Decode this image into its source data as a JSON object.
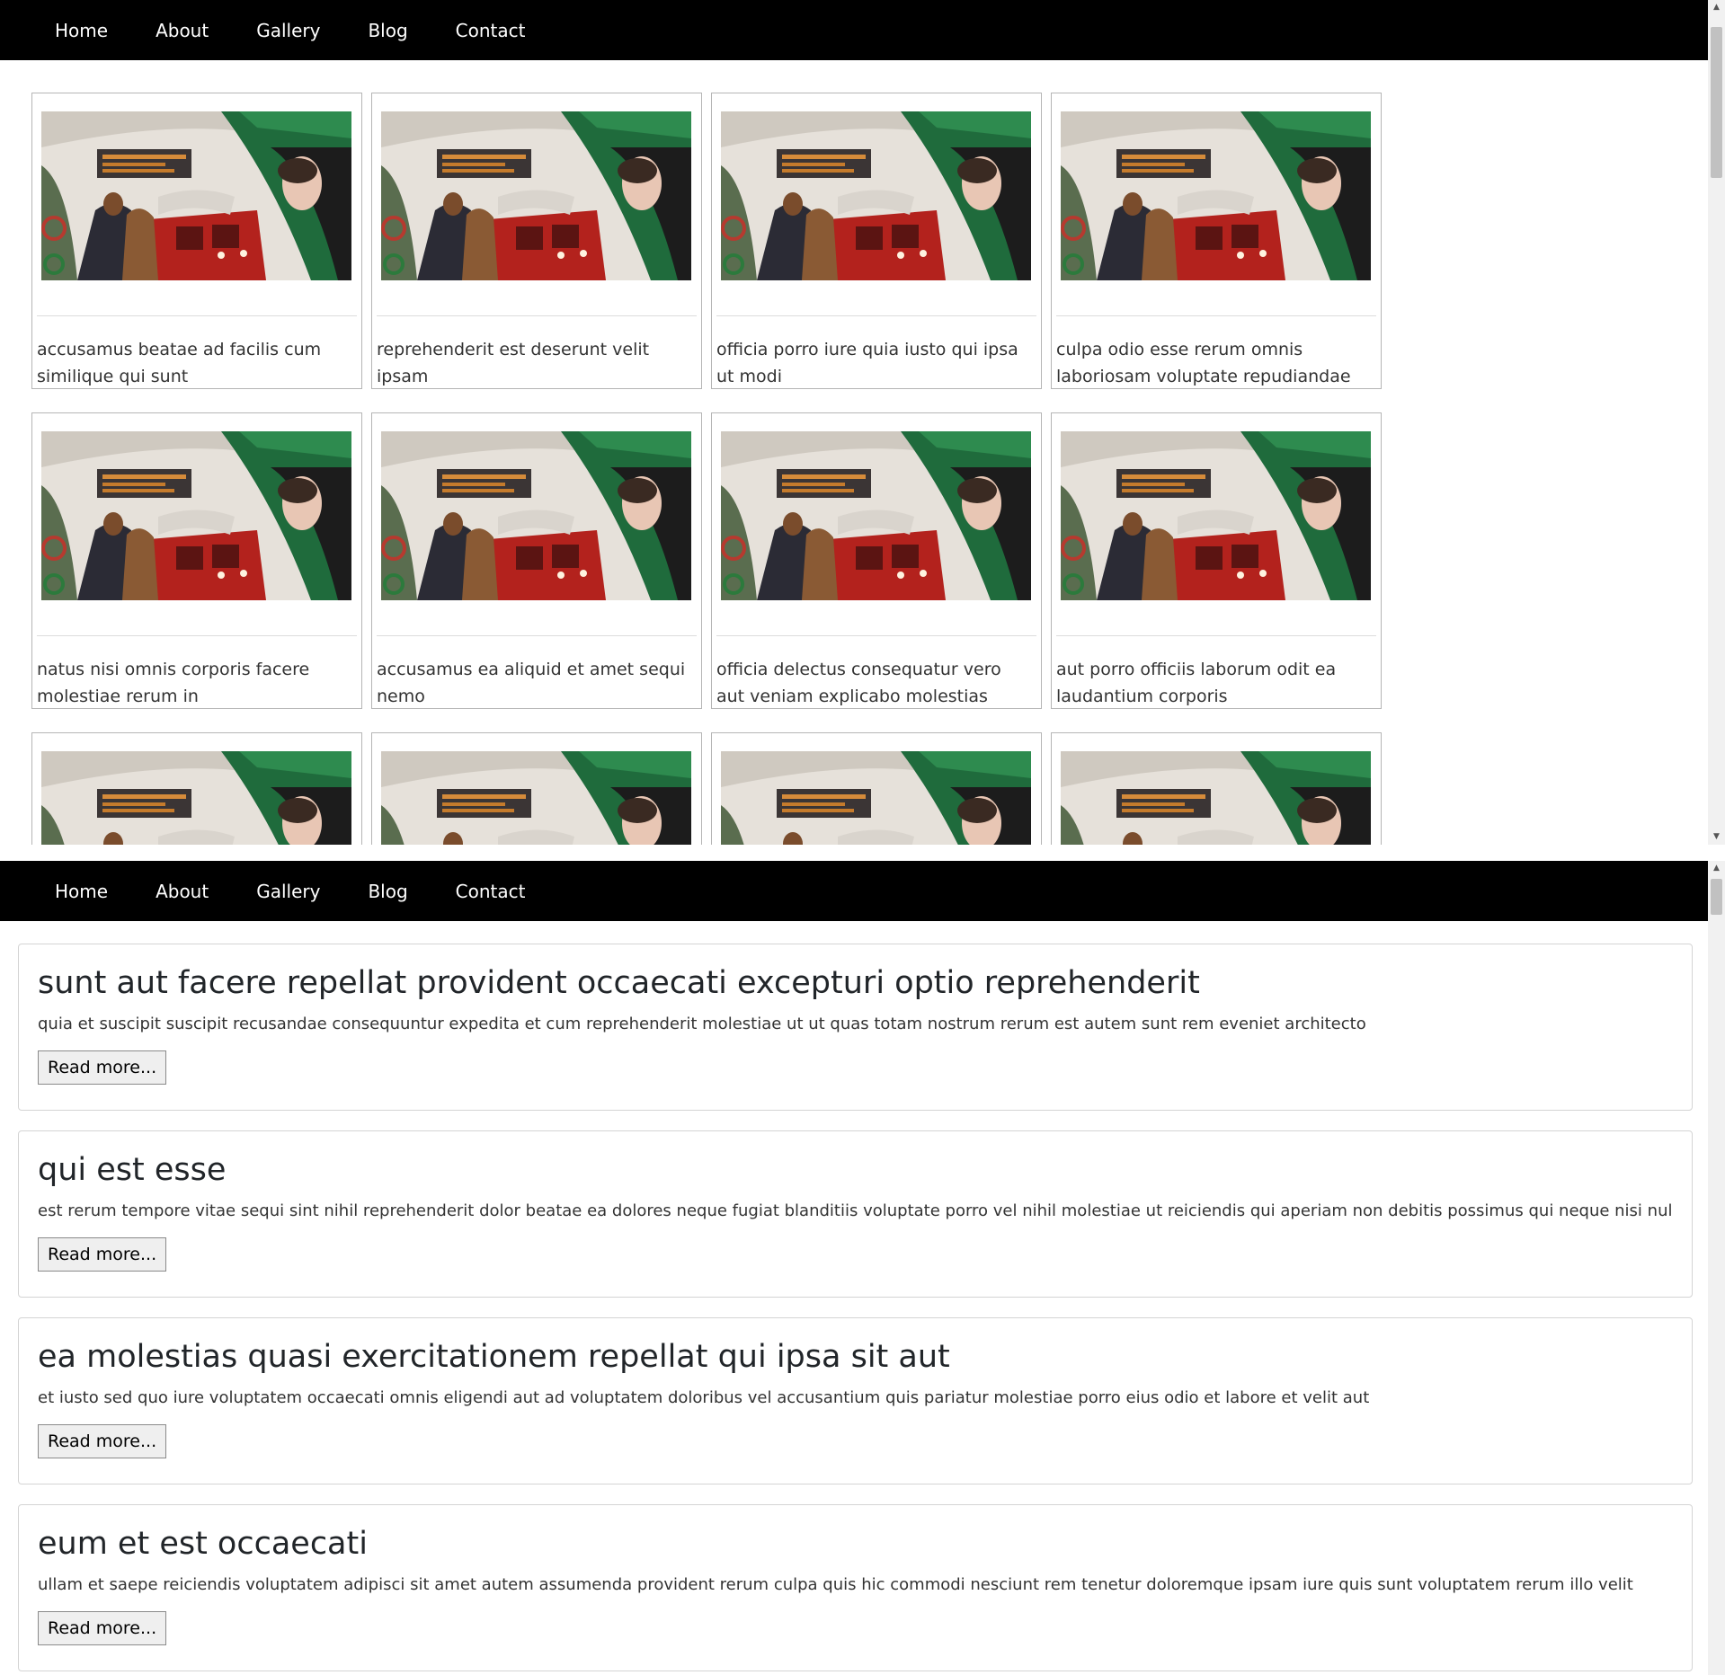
{
  "nav": {
    "items": [
      "Home",
      "About",
      "Gallery",
      "Blog",
      "Contact"
    ]
  },
  "gallery": {
    "captions": [
      "accusamus beatae ad facilis cum similique qui sunt",
      "reprehenderit est deserunt velit ipsam",
      "officia porro iure quia iusto qui ipsa ut modi",
      "culpa odio esse rerum omnis laboriosam voluptate repudiandae",
      "natus nisi omnis corporis facere molestiae rerum in",
      "accusamus ea aliquid et amet sequi nemo",
      "officia delectus consequatur vero aut veniam explicabo molestias",
      "aut porro officiis laborum odit ea laudantium corporis",
      "",
      "",
      "",
      ""
    ]
  },
  "posts": [
    {
      "title": "sunt aut facere repellat provident occaecati excepturi optio reprehenderit",
      "body": "quia et suscipit suscipit recusandae consequuntur expedita et cum reprehenderit molestiae ut ut quas totam nostrum rerum est autem sunt rem eveniet architecto",
      "button": "Read more..."
    },
    {
      "title": "qui est esse",
      "body": "est rerum tempore vitae sequi sint nihil reprehenderit dolor beatae ea dolores neque fugiat blanditiis voluptate porro vel nihil molestiae ut reiciendis qui aperiam non debitis possimus qui neque nisi nulla",
      "button": "Read more..."
    },
    {
      "title": "ea molestias quasi exercitationem repellat qui ipsa sit aut",
      "body": "et iusto sed quo iure voluptatem occaecati omnis eligendi aut ad voluptatem doloribus vel accusantium quis pariatur molestiae porro eius odio et labore et velit aut",
      "button": "Read more..."
    },
    {
      "title": "eum et est occaecati",
      "body": "ullam et saepe reiciendis voluptatem adipisci sit amet autem assumenda provident rerum culpa quis hic commodi nesciunt rem tenetur doloremque ipsam iure quis sunt voluptatem rerum illo velit",
      "button": "Read more..."
    }
  ]
}
